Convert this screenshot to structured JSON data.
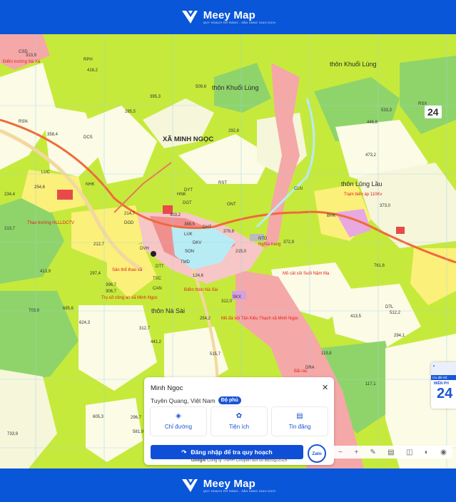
{
  "brand": {
    "name": "Meey Map",
    "tagline": "QUY HOẠCH RÕ RÀNG - SẴN SÀNG GIAO DỊCH"
  },
  "map": {
    "colors": {
      "forest_protection": "#c6ea3b",
      "production": "#8fd46a",
      "dcs": "#fbfbe6",
      "residential": "#f5a8a8",
      "river": "#f2d8a0",
      "road": "#f06a3a",
      "water": "#b8ecf5"
    },
    "place_labels": [
      {
        "text": "XÃ MINH NGỌC",
        "cls": "big"
      },
      {
        "text": "thôn Khuổi Lùng",
        "cls": "mid"
      },
      {
        "text": "thôn Khuổi Lùng",
        "cls": "mid"
      },
      {
        "text": "thôn Lũng Lầu",
        "cls": "mid"
      },
      {
        "text": "thôn Nà Sài",
        "cls": "mid"
      }
    ],
    "red_labels": [
      "Điểm trường Nà Xá",
      "Trạm biến áp 110Kv",
      "Thao trường HLLLDCTV",
      "Sân thể thao xã",
      "Trụ sở công an xã Minh Ngọc",
      "Điểm thôn Nà Sài",
      "Mỏ cát sỏi Suối Nậm Mạ",
      "Mỏ đá vôi Tân Kiều Thạch xã Minh Ngọc",
      "Nghĩa trang",
      "Bãi rác"
    ],
    "codes": [
      "RPH",
      "RSN",
      "RSX",
      "DCS",
      "LUC",
      "CSD",
      "ONT",
      "NHK",
      "BHK",
      "SON",
      "DGT",
      "DTT",
      "DYT",
      "TMD",
      "SKX",
      "RST",
      "CAN",
      "LUK",
      "CLN",
      "DKV",
      "NTD",
      "DRA",
      "HNK",
      "DTL",
      "DGD",
      "DHT",
      "TSC",
      "DVH"
    ],
    "elevations": [
      "313,9",
      "416,2",
      "395,3",
      "285,5",
      "509,8",
      "358,4",
      "473,2",
      "446,8",
      "533,3",
      "254,6",
      "234,4",
      "213,7",
      "297,4",
      "413,9",
      "306,7",
      "703,9",
      "624,3",
      "685,6",
      "441,2",
      "515,7",
      "373,0",
      "312,7",
      "212,7",
      "124,6",
      "413,5",
      "292,8",
      "215,0",
      "372,9",
      "294,1",
      "512,2",
      "119,8",
      "117,1",
      "761,6",
      "733,9",
      "605,3",
      "581,9",
      "296,7",
      "312,0",
      "388,5",
      "378,8",
      "403,2",
      "396,7",
      "214,7",
      "254,2"
    ],
    "scale_badge": "24"
  },
  "info_card": {
    "title": "Minh Ngọc",
    "location": "Tuyên Quang, Việt Nam",
    "coverage_badge": "Độ phủ",
    "actions": [
      {
        "label": "Chỉ đường",
        "icon": "directions-icon"
      },
      {
        "label": "Tiện ích",
        "icon": "amenities-icon"
      },
      {
        "label": "Tin đăng",
        "icon": "listings-icon"
      }
    ],
    "login_label": "Đăng nhập để tra quy hoạch",
    "zalo_label": "Zalo",
    "footer_google": "Google",
    "footer_text": "Công ty TNHH Chuyển đổi số BĐS@2025"
  },
  "side_box": {
    "line1": "Ưu đãi Số",
    "mien": "MIỄN PH",
    "num": "24"
  }
}
